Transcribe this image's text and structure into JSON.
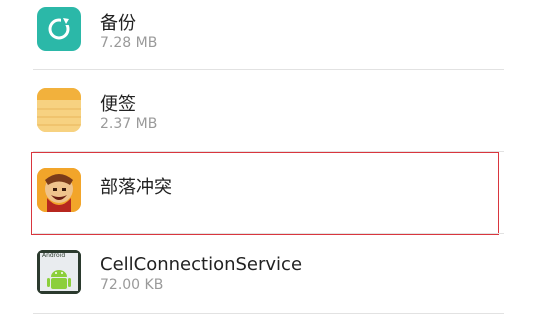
{
  "apps": [
    {
      "name": "备份",
      "size": "7.28 MB",
      "icon": "backup-icon"
    },
    {
      "name": "便签",
      "size": "2.37 MB",
      "icon": "notes-icon"
    },
    {
      "name": "部落冲突",
      "size": "",
      "icon": "clash-of-clans-icon"
    },
    {
      "name": "CellConnectionService",
      "size": "72.00 KB",
      "icon": "android-icon",
      "icon_label": "Android"
    }
  ],
  "colors": {
    "backup": "#2bb8a8",
    "notes": "#f4c055",
    "highlight": "#d9363e",
    "divider": "#e2e2e2"
  }
}
